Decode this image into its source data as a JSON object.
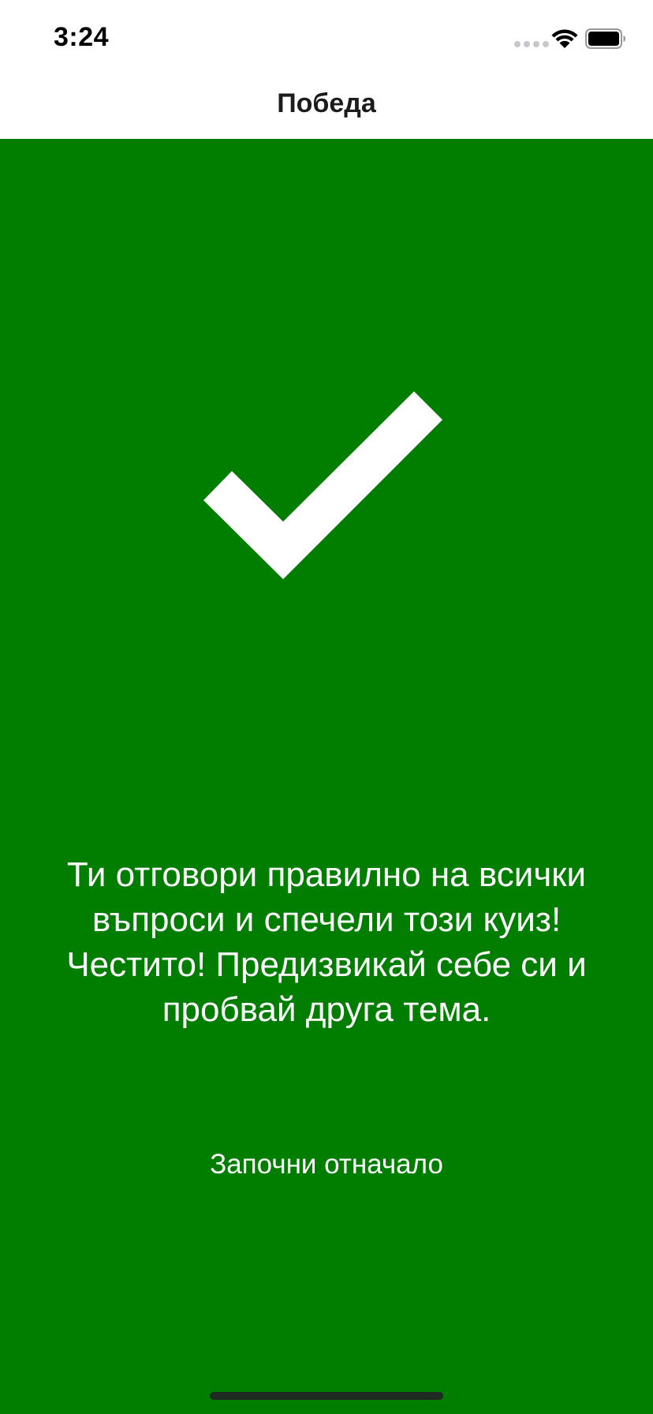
{
  "status_bar": {
    "time": "3:24",
    "signal_icon": "cellular-signal-icon",
    "wifi_icon": "wifi-icon",
    "battery_icon": "battery-icon"
  },
  "nav": {
    "title": "Победа"
  },
  "main": {
    "icon": "checkmark-icon",
    "message": "Ти отговори правилно на всички въпроси и спечели този куиз! Честито! Предизвикай себе си и пробвай друга тема.",
    "restart_label": "Започни отначало",
    "background_color": "#017d00",
    "text_color": "#ffffff"
  }
}
